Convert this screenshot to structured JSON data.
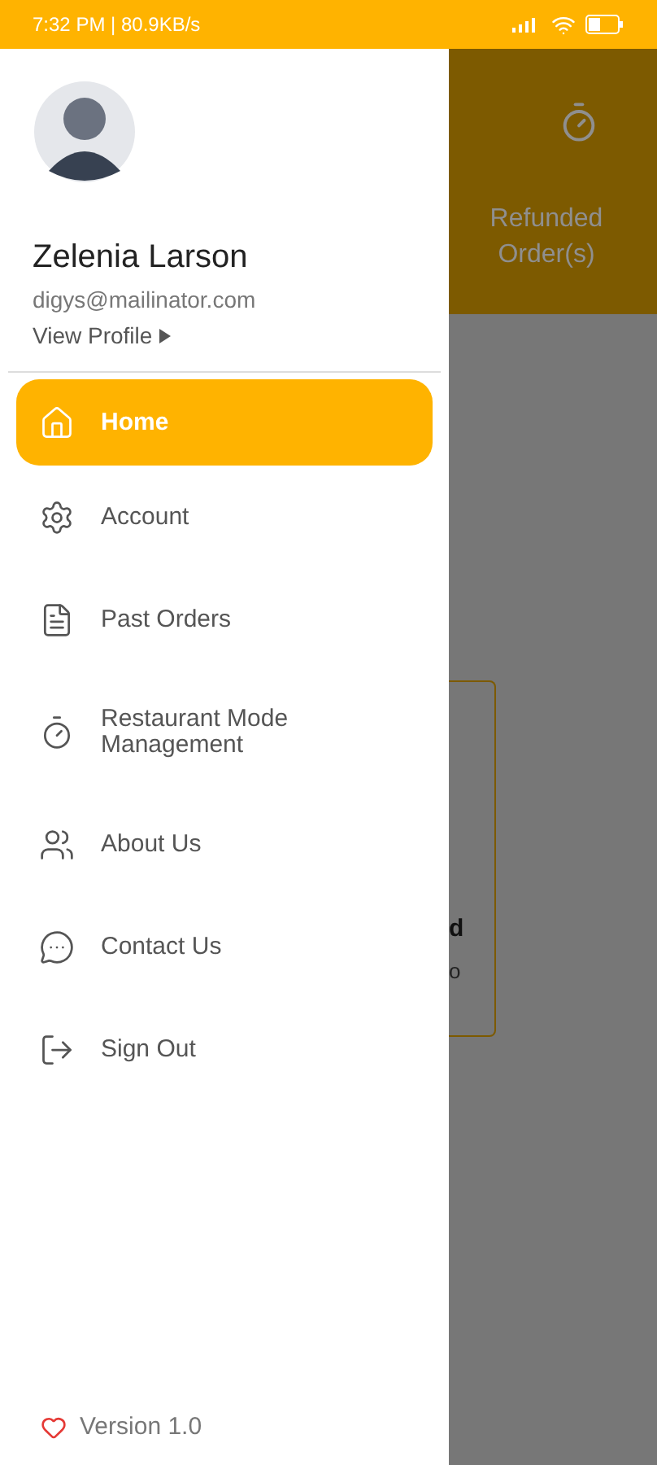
{
  "status_bar": {
    "time": "7:32 PM | 80.9KB/s"
  },
  "profile": {
    "name": "Zelenia Larson",
    "email": "digys@mailinator.com",
    "link": "View Profile"
  },
  "menu": [
    {
      "label": "Home",
      "kind": "home",
      "selected": true
    },
    {
      "label": "Account",
      "kind": "gear",
      "selected": false
    },
    {
      "label": "Past Orders",
      "kind": "document",
      "selected": false
    },
    {
      "label": "Restaurant Mode Management",
      "kind": "timer",
      "selected": false
    },
    {
      "label": "About Us",
      "kind": "people",
      "selected": false
    },
    {
      "label": "Contact Us",
      "kind": "chat",
      "selected": false
    },
    {
      "label": "Sign Out",
      "kind": "logout",
      "selected": false
    }
  ],
  "version": "Version 1.0",
  "background": {
    "header_label": "Refunded Order(s)",
    "card_fragment_1": "d",
    "card_fragment_2": "o"
  }
}
